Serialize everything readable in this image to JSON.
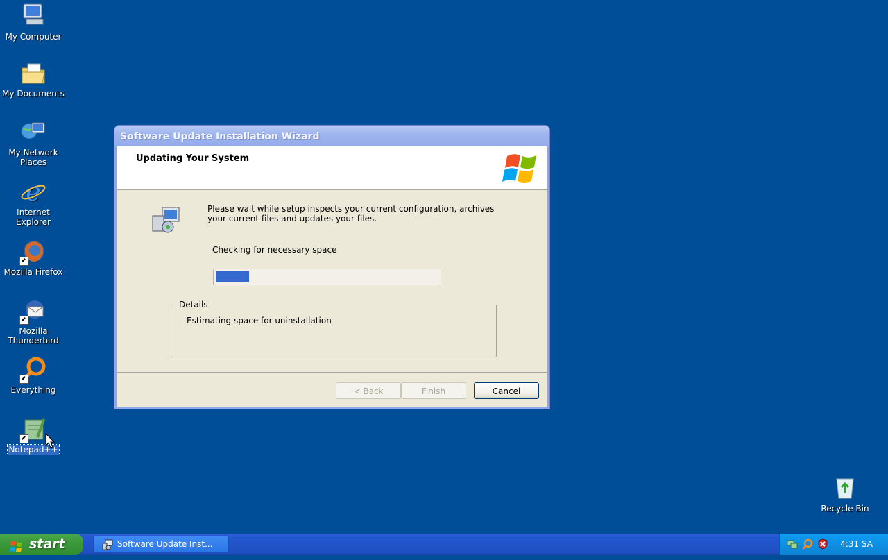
{
  "desktop": {
    "icons": [
      {
        "label": "My Computer",
        "icon": "my-computer-icon"
      },
      {
        "label": "My Documents",
        "icon": "my-documents-icon"
      },
      {
        "label": "My Network Places",
        "icon": "network-places-icon"
      },
      {
        "label": "Internet Explorer",
        "icon": "internet-explorer-icon"
      },
      {
        "label": "Mozilla Firefox",
        "icon": "firefox-icon"
      },
      {
        "label": "Mozilla Thunderbird",
        "icon": "thunderbird-icon"
      },
      {
        "label": "Everything",
        "icon": "everything-icon"
      },
      {
        "label": "Notepad++",
        "icon": "notepadpp-icon"
      },
      {
        "label": "Recycle Bin",
        "icon": "recycle-bin-icon"
      }
    ],
    "selected_icon": "Notepad++"
  },
  "wizard": {
    "title": "Software Update Installation Wizard",
    "header_title": "Updating Your System",
    "description": "Please wait while setup inspects your current configuration, archives your current files and updates your files.",
    "status": "Checking for necessary space",
    "progress_fraction": 0.15,
    "details_label": "Details",
    "details_text": "Estimating space for uninstallation",
    "buttons": {
      "back": "< Back",
      "finish": "Finish",
      "cancel": "Cancel"
    }
  },
  "taskbar": {
    "start_label": "start",
    "task_item_label": "Software Update Inst...",
    "clock": "4:31 SA"
  },
  "colors": {
    "desktop_bg": "#004e98",
    "progress_fill": "#3569cf"
  }
}
